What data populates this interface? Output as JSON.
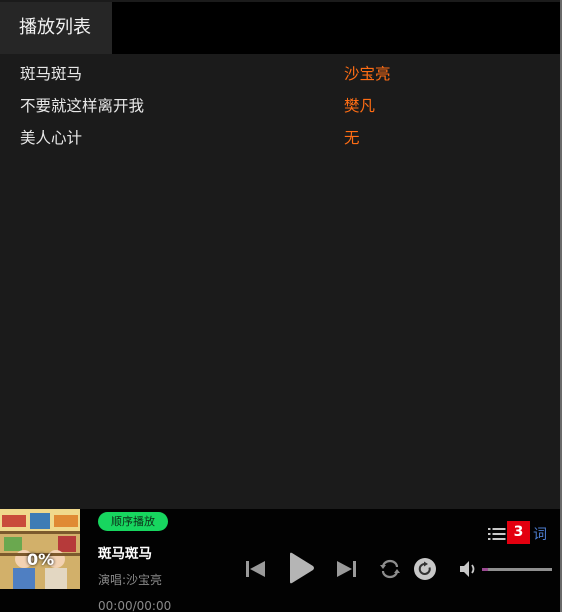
{
  "tab": {
    "label": "播放列表"
  },
  "playlist": [
    {
      "title": "斑马斑马",
      "singer": "沙宝亮"
    },
    {
      "title": "不要就这样离开我",
      "singer": "樊凡"
    },
    {
      "title": "美人心计",
      "singer": "无"
    }
  ],
  "player": {
    "cover_progress": "0%",
    "mode": "顺序播放",
    "now_title": "斑马斑马",
    "now_singer": "演唱:沙宝亮",
    "time": "00:00/00:00",
    "playlist_count": "3",
    "lyric_label": "词",
    "volume": 0.08
  },
  "icons": {
    "prev": "previous-icon",
    "play": "play-icon",
    "next": "next-icon",
    "repeat": "repeat-icon",
    "refresh": "refresh-icon",
    "volume": "volume-icon",
    "list": "list-icon"
  },
  "colors": {
    "singer": "#ff6d14",
    "badge": "#17d65f",
    "count": "#e3000f",
    "lyric": "#4d7dd1"
  }
}
